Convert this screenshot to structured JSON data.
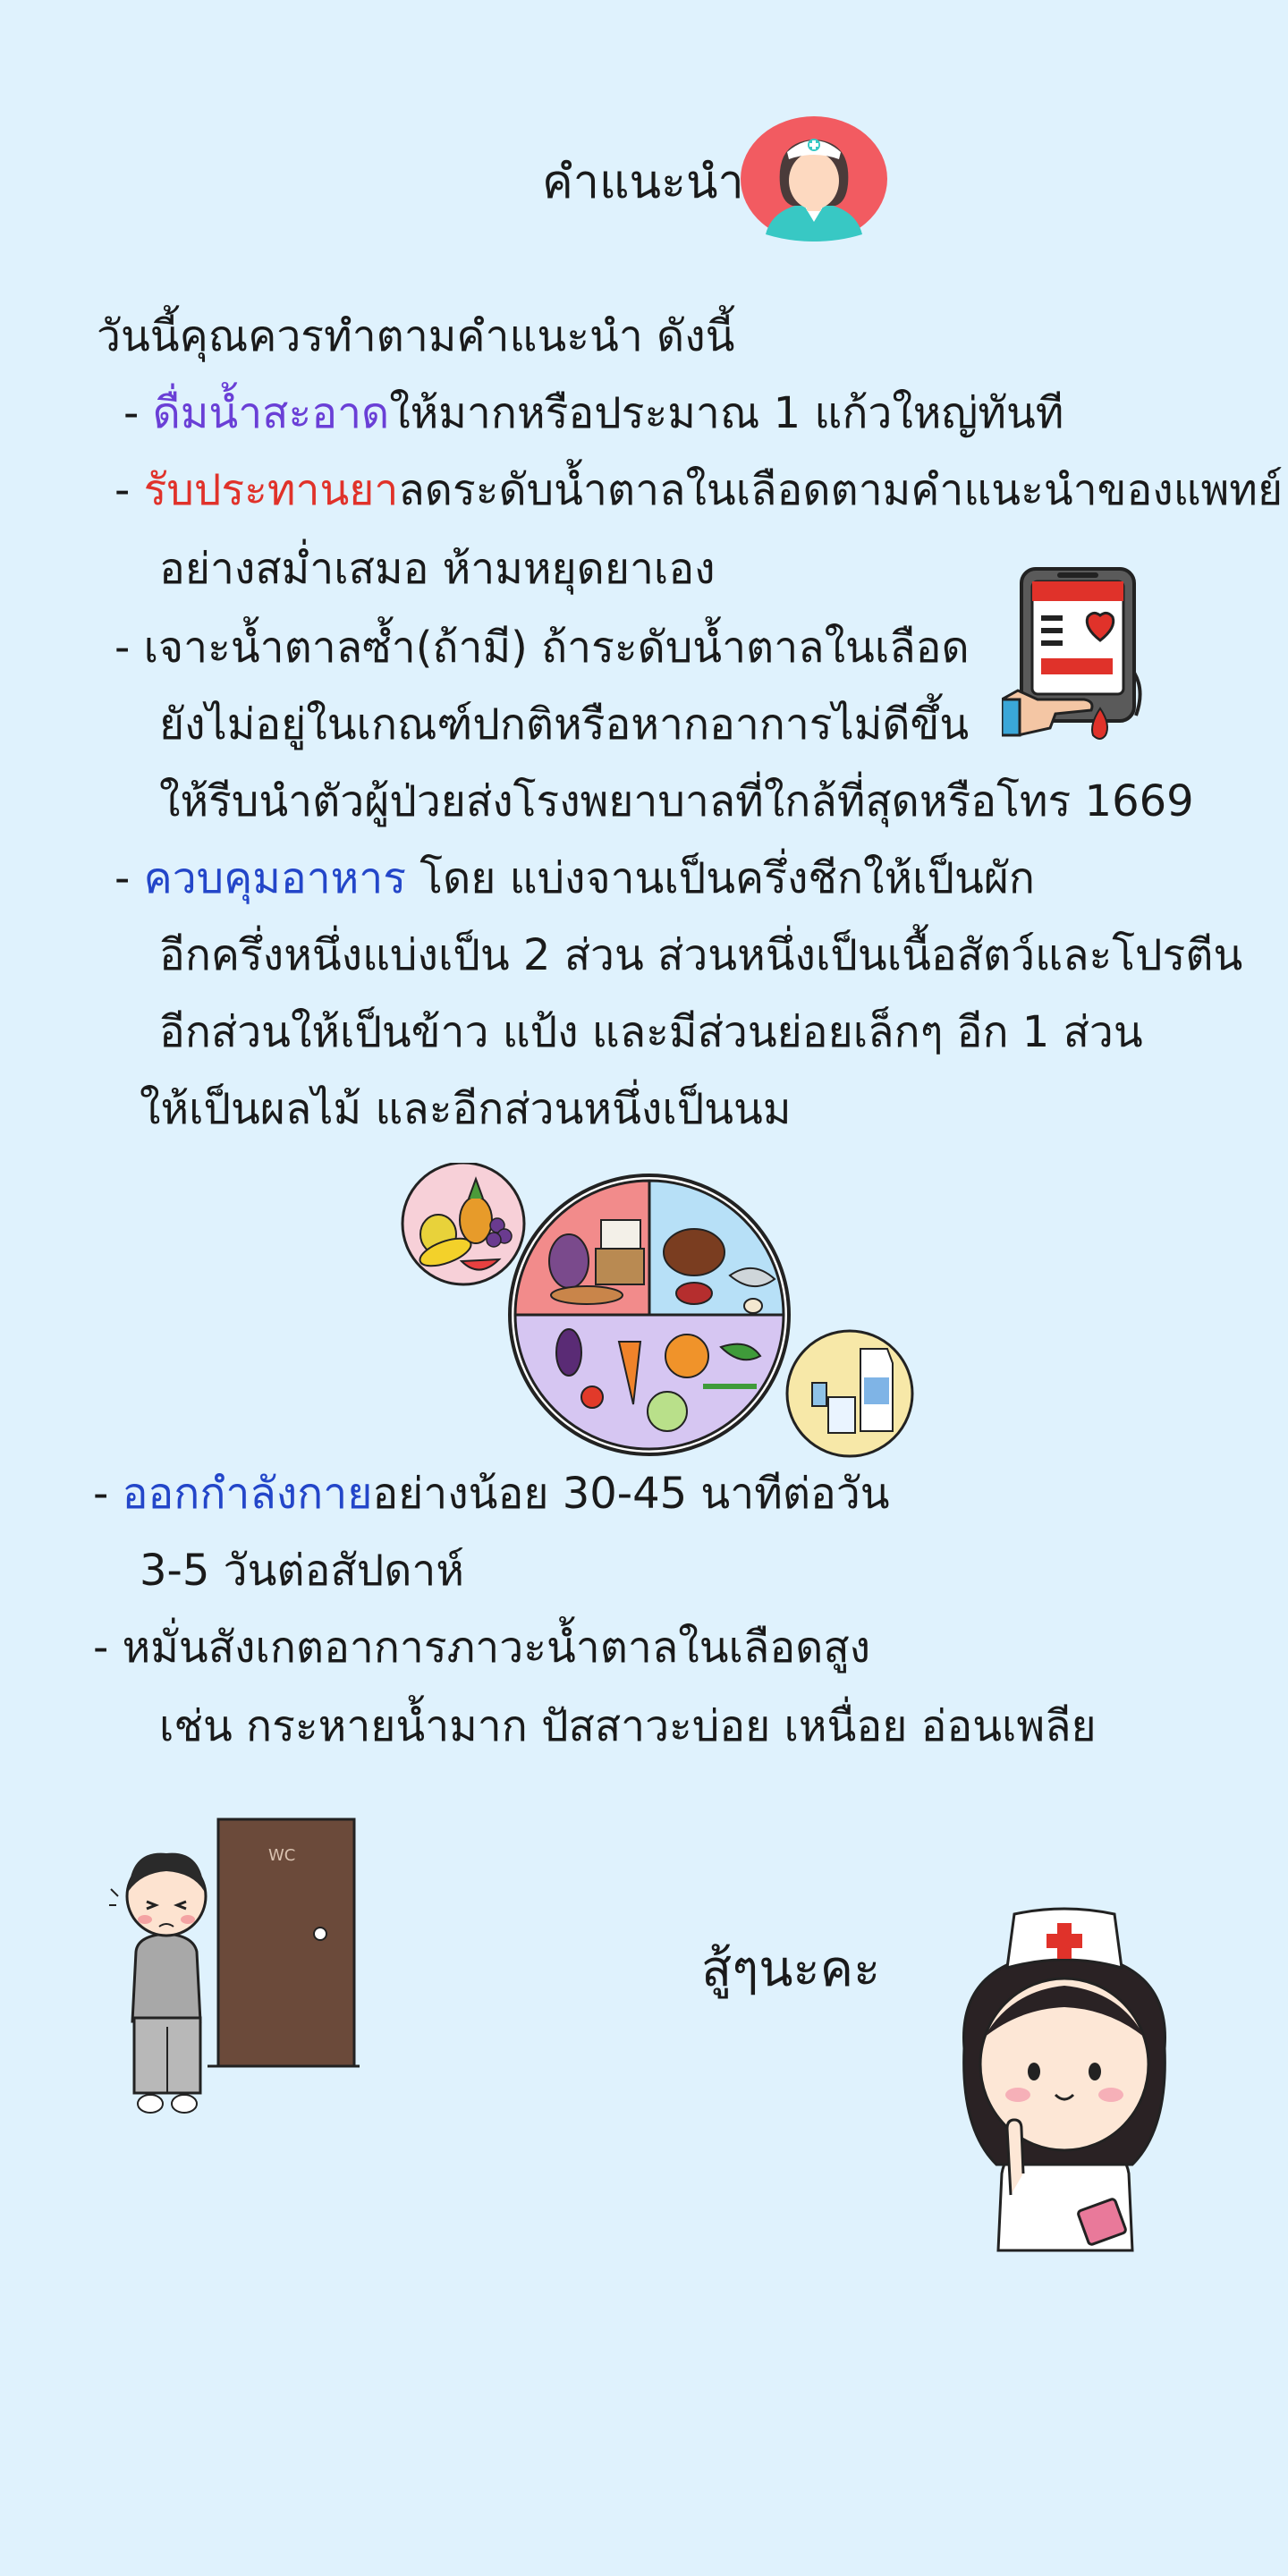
{
  "header": {
    "title": "คำแนะนำ"
  },
  "intro": "วันนี้คุณควรทำตามคำแนะนำ ดังนี้",
  "items": [
    {
      "dash": "-",
      "highlight": "ดื่มน้ำสะอาด",
      "rest": "ให้มากหรือประมาณ 1 แก้วใหญ่ทันที",
      "color": "#6a3fd6"
    },
    {
      "dash": "-",
      "highlight": "รับประทานยา",
      "rest": "ลดระดับน้ำตาลในเลือดตามคำแนะนำของแพทย์",
      "cont": [
        "อย่างสม่ำเสมอ ห้ามหยุดยาเอง"
      ],
      "color": "#e0322a"
    },
    {
      "dash": "-",
      "highlight": "",
      "rest": "เจาะน้ำตาลซ้ำ(ถ้ามี) ถ้าระดับน้ำตาลในเลือด",
      "cont": [
        "ยังไม่อยู่ในเกณฑ์ปกติหรือหากอาการไม่ดีขึ้น",
        "ให้รีบนำตัวผู้ป่วยส่งโรงพยาบาลที่ใกล้ที่สุดหรือโทร 1669"
      ]
    },
    {
      "dash": "-",
      "highlight": "ควบคุมอาหาร",
      "rest": " โดย แบ่งจานเป็นครึ่งชีกให้เป็นผัก",
      "cont": [
        "อีกครึ่งหนึ่งแบ่งเป็น 2 ส่วน ส่วนหนึ่งเป็นเนื้อสัตว์และโปรตีน",
        "อีกส่วนให้เป็นข้าว แป้ง และมีส่วนย่อยเล็กๆ อีก 1 ส่วน",
        "ให้เป็นผลไม้ และอีกส่วนหนึ่งเป็นนม"
      ],
      "color": "#2346c9"
    },
    {
      "dash": "-",
      "highlight": "ออกกำลังกาย",
      "rest": "อย่างน้อย 30-45 นาทีต่อวัน",
      "cont": [
        "3-5 วันต่อสัปดาห์"
      ],
      "color": "#2346c9"
    },
    {
      "dash": "-",
      "highlight": "",
      "rest": "หมั่นสังเกตอาการภาวะน้ำตาลในเลือดสูง",
      "cont": [
        "เช่น กระหายน้ำมาก ปัสสาวะบ่อย เหนื่อย อ่อนเพลีย"
      ]
    }
  ],
  "door_sign": "WC",
  "cheer": "สู้ๆนะคะ",
  "icons": {
    "nurse_avatar": "nurse-avatar-icon",
    "glucose_meter": "glucose-meter-icon",
    "food_plate": "healthy-plate-illustration",
    "fruit_bowl": "fruit-bowl-illustration",
    "milk": "milk-illustration",
    "boy_toilet": "boy-waiting-toilet-illustration",
    "nurse_cartoon": "nurse-cartoon-illustration"
  },
  "colors": {
    "background": "#dff2fd",
    "purple": "#6a3fd6",
    "red": "#e0322a",
    "blue": "#2346c9"
  }
}
